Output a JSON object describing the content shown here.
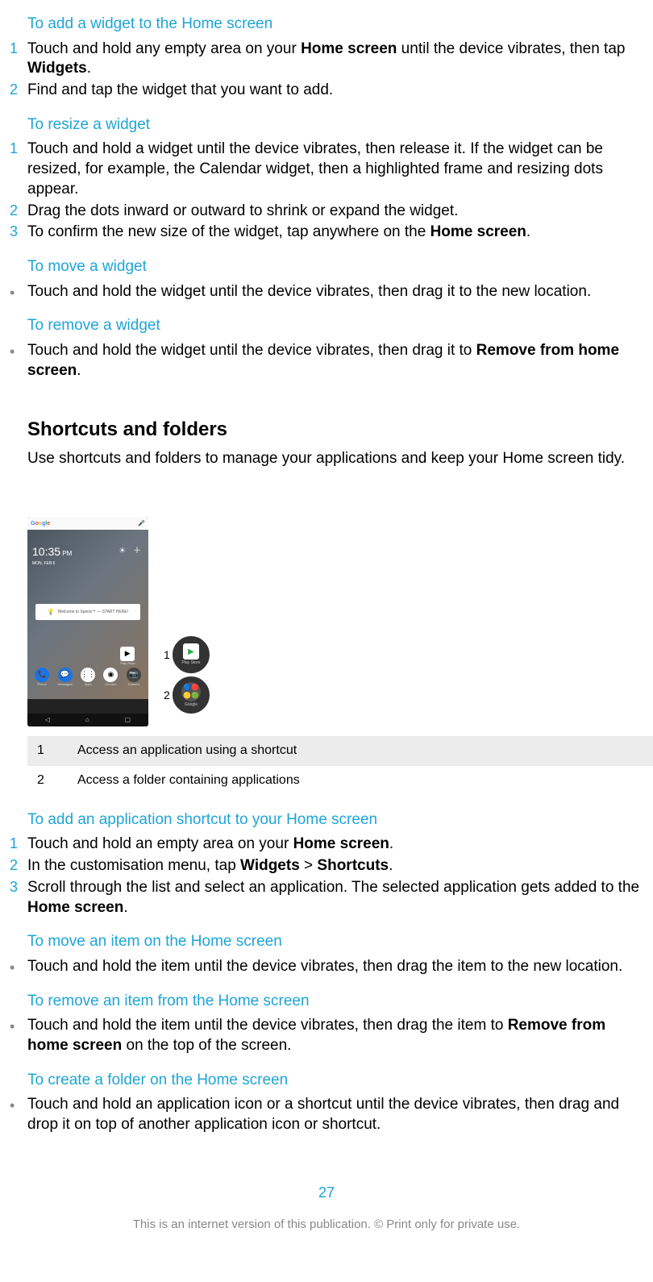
{
  "sections": {
    "addWidget": {
      "heading": "To add a widget to the Home screen",
      "steps": [
        {
          "pre": "Touch and hold any empty area on your ",
          "bold1": "Home screen",
          "mid": " until the device vibrates, then tap ",
          "bold2": "Widgets",
          "post": "."
        },
        {
          "text": "Find and tap the widget that you want to add."
        }
      ]
    },
    "resizeWidget": {
      "heading": "To resize a widget",
      "steps": [
        {
          "text": "Touch and hold a widget until the device vibrates, then release it. If the widget can be resized, for example, the Calendar widget, then a highlighted frame and resizing dots appear."
        },
        {
          "text": "Drag the dots inward or outward to shrink or expand the widget."
        },
        {
          "pre": "To confirm the new size of the widget, tap anywhere on the ",
          "bold1": "Home screen",
          "post": "."
        }
      ]
    },
    "moveWidget": {
      "heading": "To move a widget",
      "bullet": {
        "text": "Touch and hold the widget until the device vibrates, then drag it to the new location."
      }
    },
    "removeWidget": {
      "heading": "To remove a widget",
      "bullet": {
        "pre": "Touch and hold the widget until the device vibrates, then drag it to ",
        "bold1": "Remove from home screen",
        "post": "."
      }
    },
    "shortcutsFolders": {
      "heading": "Shortcuts and folders",
      "body": "Use shortcuts and folders to manage your applications and keep your Home screen tidy."
    },
    "legend": {
      "r1": {
        "num": "1",
        "text": "Access an application using a shortcut"
      },
      "r2": {
        "num": "2",
        "text": "Access a folder containing applications"
      }
    },
    "addShortcut": {
      "heading": "To add an application shortcut to your Home screen",
      "steps": [
        {
          "pre": "Touch and hold an empty area on your ",
          "bold1": "Home screen",
          "post": "."
        },
        {
          "pre": "In the customisation menu, tap ",
          "bold1": "Widgets",
          "mid": " > ",
          "bold2": "Shortcuts",
          "post": "."
        },
        {
          "pre": "Scroll through the list and select an application. The selected application gets added to the ",
          "bold1": "Home screen",
          "post": "."
        }
      ]
    },
    "moveItem": {
      "heading": "To move an item on the Home screen",
      "bullet": {
        "text": "Touch and hold the item until the device vibrates, then drag the item to the new location."
      }
    },
    "removeItem": {
      "heading": "To remove an item from the Home screen",
      "bullet": {
        "pre": "Touch and hold the item until the device vibrates, then drag the item to ",
        "bold1": "Remove from home screen",
        "post": " on the top of the screen."
      }
    },
    "createFolder": {
      "heading": "To create a folder on the Home screen",
      "bullet": {
        "text": "Touch and hold an application icon or a shortcut until the device vibrates, then drag and drop it on top of another application icon or shortcut."
      }
    }
  },
  "figure": {
    "clockTime": "10:35",
    "clockAmPm": "PM",
    "clockDate": "MON, FEB 6",
    "welcome": "Welcome to Xperia™ — START HERE!",
    "callout1": {
      "marker": "1",
      "caption": "Play Store"
    },
    "callout2": {
      "marker": "2",
      "caption": "Google"
    },
    "apps": [
      "Phone",
      "Messages",
      "Apps",
      "Chrome",
      "Camera",
      "Play Store"
    ]
  },
  "pageNumber": "27",
  "footer": "This is an internet version of this publication. © Print only for private use."
}
